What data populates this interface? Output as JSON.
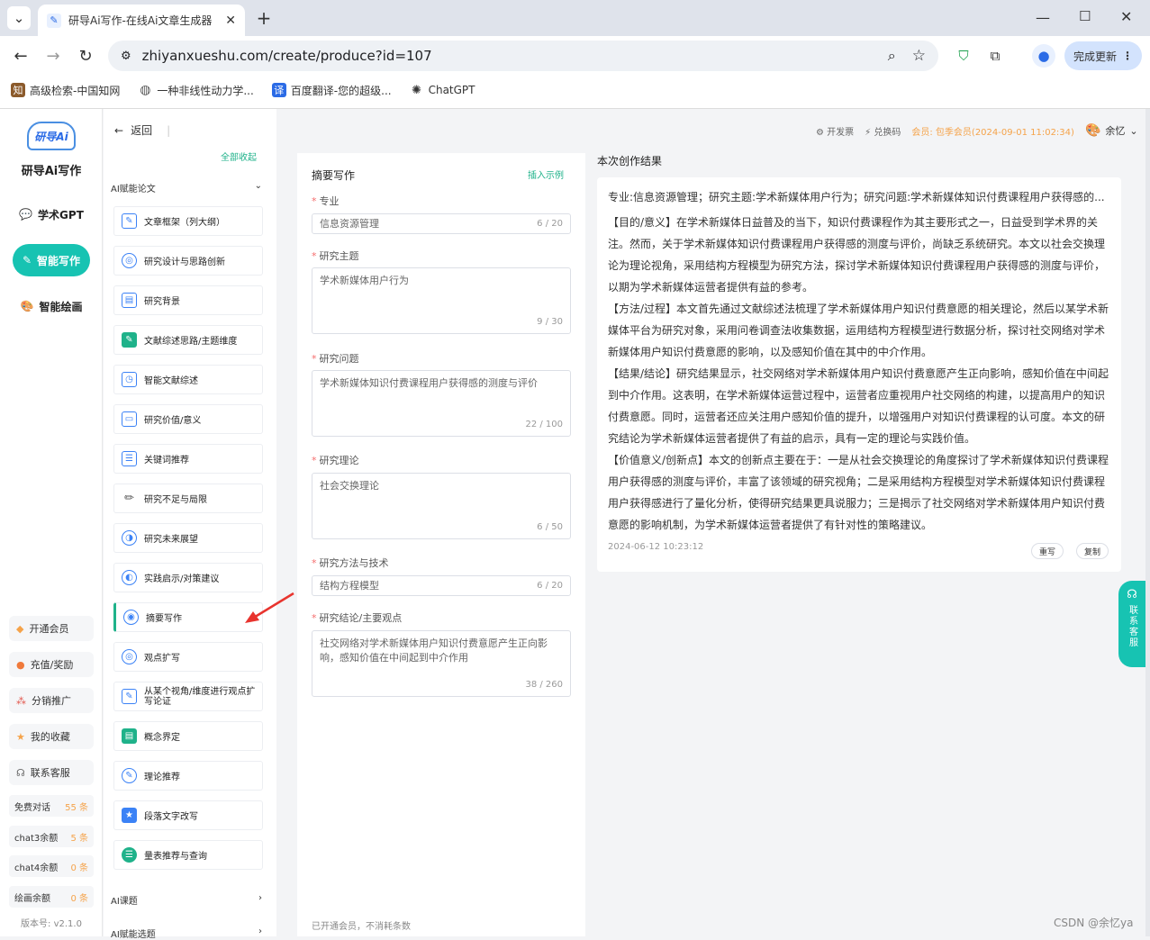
{
  "browser": {
    "tab_title": "研导Ai写作-在线Ai文章生成器",
    "url": "zhiyanxueshu.com/create/produce?id=107",
    "update_label": "完成更新",
    "bookmarks": [
      {
        "label": "高级检索-中国知网",
        "icon": "cnki-icon"
      },
      {
        "label": "一种非线性动力学...",
        "icon": "globe-icon"
      },
      {
        "label": "百度翻译-您的超级...",
        "icon": "translate-icon"
      },
      {
        "label": "ChatGPT",
        "icon": "chatgpt-icon"
      }
    ]
  },
  "sidebar": {
    "logo_text": "研导Ai",
    "app_name": "研导Ai写作",
    "nav": [
      {
        "label": "学术GPT",
        "active": false
      },
      {
        "label": "智能写作",
        "active": true
      },
      {
        "label": "智能绘画",
        "active": false
      }
    ],
    "bottom": [
      {
        "label": "开通会员"
      },
      {
        "label": "充值/奖励"
      },
      {
        "label": "分销推广"
      },
      {
        "label": "我的收藏"
      },
      {
        "label": "联系客服"
      }
    ],
    "quotas": [
      {
        "label": "免费对话",
        "value": "55 条"
      },
      {
        "label": "chat3余额",
        "value": "5 条"
      },
      {
        "label": "chat4余额",
        "value": "0 条"
      },
      {
        "label": "绘画余额",
        "value": "0 条"
      }
    ],
    "version": "版本号: v2.1.0"
  },
  "tools": {
    "back_label": "返回",
    "collapse_all": "全部收起",
    "group_title": "AI赋能论文",
    "items": [
      {
        "label": "文章框架（列大纲）",
        "color": "#3b82f6"
      },
      {
        "label": "研究设计与思路创新",
        "color": "#3b82f6"
      },
      {
        "label": "研究背景",
        "color": "#3b82f6"
      },
      {
        "label": "文献综述思路/主题维度",
        "color": "#1fb28a"
      },
      {
        "label": "智能文献综述",
        "color": "#3b82f6"
      },
      {
        "label": "研究价值/意义",
        "color": "#3b82f6"
      },
      {
        "label": "关键词推荐",
        "color": "#3b82f6"
      },
      {
        "label": "研究不足与局限",
        "color": "#555555"
      },
      {
        "label": "研究未来展望",
        "color": "#3b82f6"
      },
      {
        "label": "实践启示/对策建议",
        "color": "#3b82f6"
      },
      {
        "label": "摘要写作",
        "color": "#3b82f6"
      },
      {
        "label": "观点扩写",
        "color": "#3b82f6"
      },
      {
        "label": "从某个视角/维度进行观点扩写论证",
        "color": "#3b82f6"
      },
      {
        "label": "概念界定",
        "color": "#1fb28a"
      },
      {
        "label": "理论推荐",
        "color": "#3b82f6"
      },
      {
        "label": "段落文字改写",
        "color": "#3b82f6"
      },
      {
        "label": "量表推荐与查询",
        "color": "#1fb28a"
      }
    ],
    "group2": "AI课题",
    "group3": "AI赋能选题"
  },
  "header": {
    "invoice": "开发票",
    "redeem": "兑换码",
    "member": "会员: 包季会员(2024-09-01 11:02:34)",
    "user": "余忆"
  },
  "form": {
    "title": "摘要写作",
    "insert_example": "插入示例",
    "fields": [
      {
        "label": "专业",
        "value": "信息资源管理",
        "count": "6 / 20"
      },
      {
        "label": "研究主题",
        "value": "学术新媒体用户行为",
        "count": "9 / 30"
      },
      {
        "label": "研究问题",
        "value": "学术新媒体知识付费课程用户获得感的测度与评价",
        "count": "22 / 100"
      },
      {
        "label": "研究理论",
        "value": "社会交换理论",
        "count": "6 / 50"
      },
      {
        "label": "研究方法与技术",
        "value": "结构方程模型",
        "count": "6 / 20"
      },
      {
        "label": "研究结论/主要观点",
        "value": "社交网络对学术新媒体用户知识付费意愿产生正向影响，感知价值在中间起到中介作用",
        "count": "38 / 260"
      }
    ],
    "footer": "已开通会员，不消耗条数"
  },
  "result": {
    "title": "本次创作结果",
    "summary": "专业:信息资源管理；研究主题:学术新媒体用户行为；研究问题:学术新媒体知识付费课程用户获得感的...",
    "p1": "【目的/意义】在学术新媒体日益普及的当下，知识付费课程作为其主要形式之一，日益受到学术界的关注。然而，关于学术新媒体知识付费课程用户获得感的测度与评价，尚缺乏系统研究。本文以社会交换理论为理论视角，采用结构方程模型为研究方法，探讨学术新媒体知识付费课程用户获得感的测度与评价，以期为学术新媒体运营者提供有益的参考。",
    "p2": "【方法/过程】本文首先通过文献综述法梳理了学术新媒体用户知识付费意愿的相关理论，然后以某学术新媒体平台为研究对象，采用问卷调查法收集数据，运用结构方程模型进行数据分析，探讨社交网络对学术新媒体用户知识付费意愿的影响，以及感知价值在其中的中介作用。",
    "p3": "【结果/结论】研究结果显示，社交网络对学术新媒体用户知识付费意愿产生正向影响，感知价值在中间起到中介作用。这表明，在学术新媒体运营过程中，运营者应重视用户社交网络的构建，以提高用户的知识付费意愿。同时，运营者还应关注用户感知价值的提升，以增强用户对知识付费课程的认可度。本文的研究结论为学术新媒体运营者提供了有益的启示，具有一定的理论与实践价值。",
    "p4": "【价值意义/创新点】本文的创新点主要在于：一是从社会交换理论的角度探讨了学术新媒体知识付费课程用户获得感的测度与评价，丰富了该领域的研究视角；二是采用结构方程模型对学术新媒体知识付费课程用户获得感进行了量化分析，使得研究结果更具说服力；三是揭示了社交网络对学术新媒体用户知识付费意愿的影响机制，为学术新媒体运营者提供了有针对性的策略建议。",
    "timestamp": "2024-06-12 10:23:12",
    "rewrite": "重写",
    "copy": "复制"
  },
  "float_service": "联系客服",
  "watermark": "CSDN @余忆ya",
  "colors": {
    "accent": "#1fb28a",
    "nav_active": "#17c3b2",
    "member": "#f5a34a"
  }
}
